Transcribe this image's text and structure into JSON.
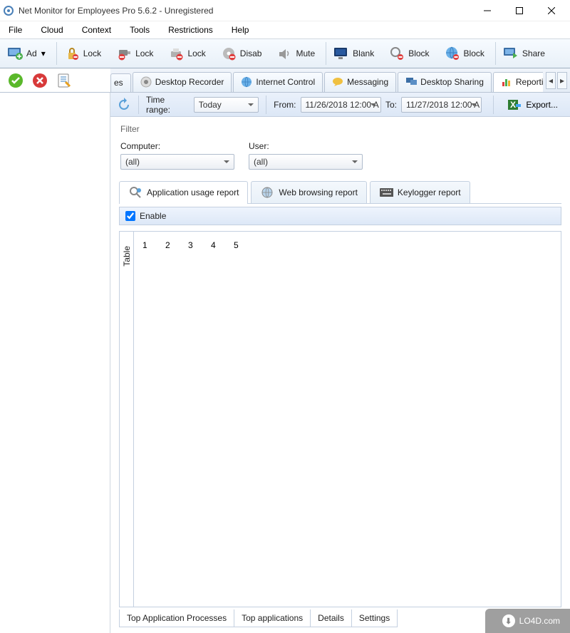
{
  "window": {
    "title": "Net Monitor for Employees Pro 5.6.2 - Unregistered"
  },
  "menu": [
    "File",
    "Cloud",
    "Context",
    "Tools",
    "Restrictions",
    "Help"
  ],
  "toolbar": [
    {
      "label": "Ad",
      "icon": "monitor-add",
      "dropdown": true
    },
    {
      "label": "Lock",
      "icon": "padlock"
    },
    {
      "label": "Lock",
      "icon": "usb-lock"
    },
    {
      "label": "Lock",
      "icon": "printer-lock"
    },
    {
      "label": "Disab",
      "icon": "disk-disable"
    },
    {
      "label": "Mute",
      "icon": "speaker-mute"
    },
    {
      "label": "Blank",
      "icon": "monitor-blank"
    },
    {
      "label": "Block",
      "icon": "magnify-block"
    },
    {
      "label": "Block",
      "icon": "globe-block"
    },
    {
      "label": "Share",
      "icon": "monitor-share"
    }
  ],
  "main_tabs": {
    "partial": "es",
    "items": [
      {
        "label": "Desktop Recorder",
        "icon": "record"
      },
      {
        "label": "Internet Control",
        "icon": "globe"
      },
      {
        "label": "Messaging",
        "icon": "chat"
      },
      {
        "label": "Desktop Sharing",
        "icon": "monitors"
      },
      {
        "label": "Reporting",
        "icon": "bar-chart",
        "active": true
      }
    ]
  },
  "timebar": {
    "label": "Time range:",
    "range_value": "Today",
    "from_label": "From:",
    "from_value": "11/26/2018 12:00 A",
    "to_label": "To:",
    "to_value": "11/27/2018 12:00 A",
    "export_label": "Export..."
  },
  "filter": {
    "title": "Filter",
    "computer_label": "Computer:",
    "computer_value": "(all)",
    "user_label": "User:",
    "user_value": "(all)"
  },
  "report_tabs": [
    {
      "label": "Application usage report",
      "icon": "search-app",
      "active": true
    },
    {
      "label": "Web browsing report",
      "icon": "globe"
    },
    {
      "label": "Keylogger report",
      "icon": "keyboard"
    }
  ],
  "enable": {
    "label": "Enable",
    "checked": true
  },
  "table": {
    "vtab": "Table",
    "cols": [
      "1",
      "2",
      "3",
      "4",
      "5"
    ]
  },
  "bottom_tabs": [
    "Top Application Processes",
    "Top applications",
    "Details",
    "Settings"
  ],
  "watermark": "LO4D.com"
}
